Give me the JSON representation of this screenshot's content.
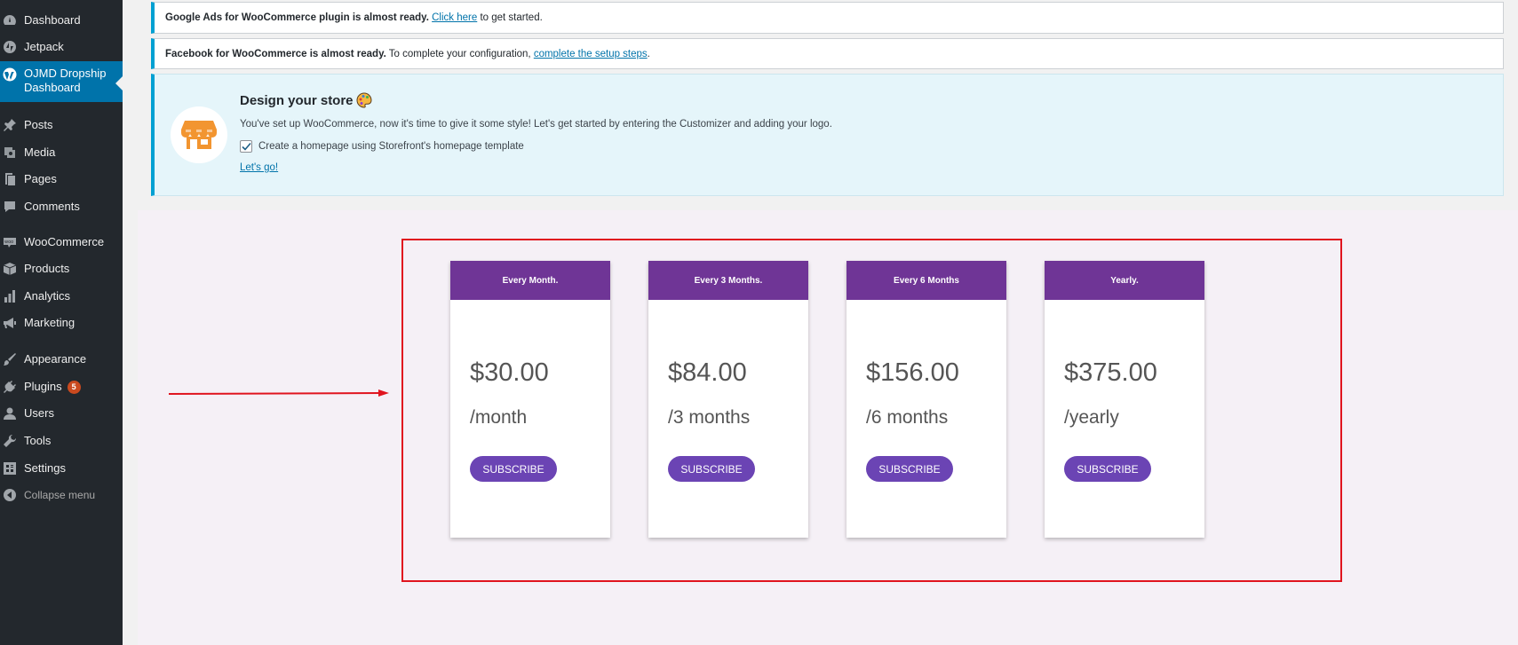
{
  "sidebar": {
    "items": [
      {
        "label": "Dashboard",
        "icon": "dashboard-icon"
      },
      {
        "label": "Jetpack",
        "icon": "jetpack-icon"
      },
      {
        "label": "OJMD Dropship Dashboard",
        "icon": "wordpress-icon"
      },
      {
        "label": "Posts",
        "icon": "pushpin-icon"
      },
      {
        "label": "Media",
        "icon": "media-icon"
      },
      {
        "label": "Pages",
        "icon": "pages-icon"
      },
      {
        "label": "Comments",
        "icon": "comment-icon"
      },
      {
        "label": "WooCommerce",
        "icon": "woo-icon"
      },
      {
        "label": "Products",
        "icon": "box-icon"
      },
      {
        "label": "Analytics",
        "icon": "bar-chart-icon"
      },
      {
        "label": "Marketing",
        "icon": "megaphone-icon"
      },
      {
        "label": "Appearance",
        "icon": "brush-icon"
      },
      {
        "label": "Plugins",
        "icon": "plug-icon",
        "badge": "5"
      },
      {
        "label": "Users",
        "icon": "user-icon"
      },
      {
        "label": "Tools",
        "icon": "wrench-icon"
      },
      {
        "label": "Settings",
        "icon": "settings-icon"
      },
      {
        "label": "Collapse menu",
        "icon": "collapse-icon"
      }
    ]
  },
  "notices": {
    "google": {
      "bold": "Google Ads for WooCommerce plugin is almost ready.",
      "link": "Click here",
      "after": " to get started."
    },
    "facebook": {
      "bold": "Facebook for WooCommerce is almost ready.",
      "mid": " To complete your configuration, ",
      "link": "complete the setup steps",
      "after": "."
    }
  },
  "design": {
    "title": "Design your store",
    "description": "You've set up WooCommerce, now it's time to give it some style! Let's get started by entering the Customizer and adding your logo.",
    "checkbox_label": "Create a homepage using Storefront's homepage template",
    "link": "Let's go!"
  },
  "plans": [
    {
      "name": "Every Month.",
      "price": "$30.00",
      "period": "/month",
      "button": "SUBSCRIBE"
    },
    {
      "name": "Every 3 Months.",
      "price": "$84.00",
      "period": "/3 months",
      "button": "SUBSCRIBE"
    },
    {
      "name": "Every 6 Months",
      "price": "$156.00",
      "period": "/6 months",
      "button": "SUBSCRIBE"
    },
    {
      "name": "Yearly.",
      "price": "$375.00",
      "period": "/yearly",
      "button": "SUBSCRIBE"
    }
  ],
  "colors": {
    "sidebar": "#23282d",
    "active": "#0073aa",
    "plan_header": "#6f3596",
    "subscribe": "#6b44b4",
    "highlight": "#e0141e"
  }
}
